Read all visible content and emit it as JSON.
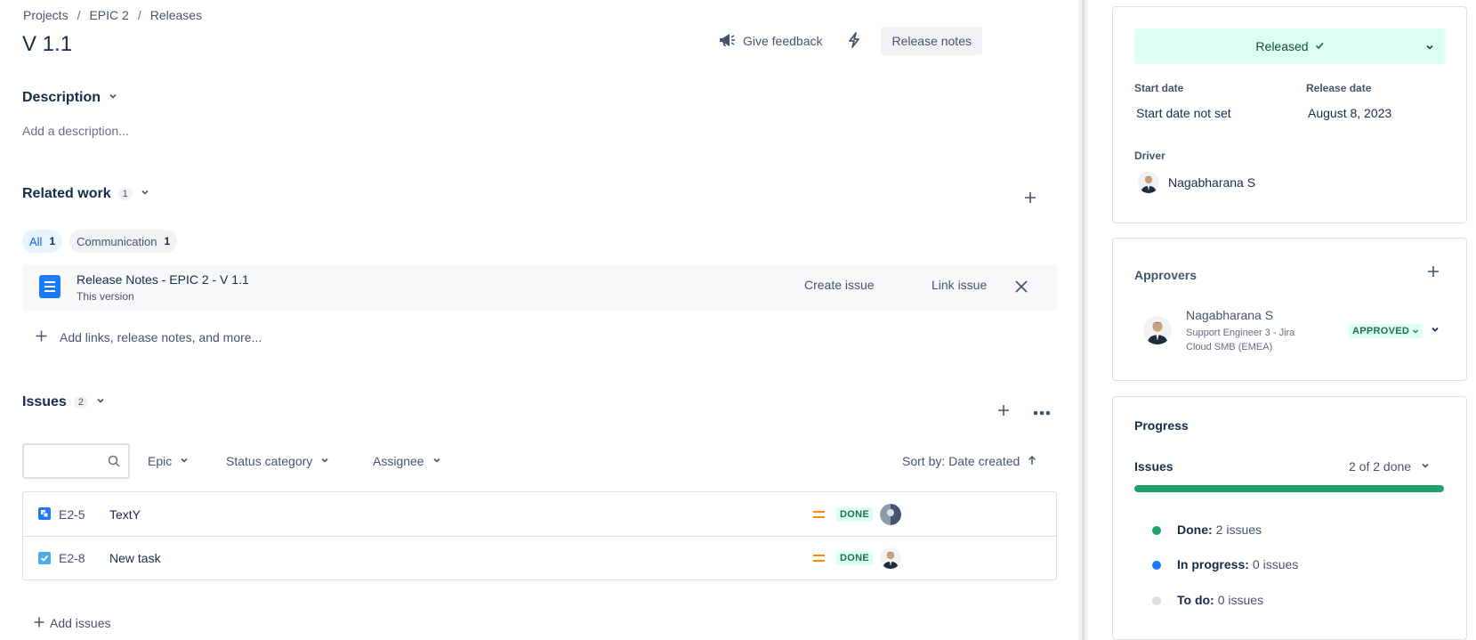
{
  "breadcrumb": [
    "Projects",
    "EPIC 2",
    "Releases"
  ],
  "page_title": "V 1.1",
  "header": {
    "feedback_label": "Give feedback",
    "release_notes_label": "Release notes"
  },
  "description": {
    "title": "Description",
    "placeholder": "Add a description..."
  },
  "related_work": {
    "title": "Related work",
    "count": "1",
    "chips": [
      {
        "label": "All",
        "count": "1"
      },
      {
        "label": "Communication",
        "count": "1"
      }
    ],
    "item": {
      "title": "Release Notes - EPIC 2 - V 1.1",
      "subtitle": "This version",
      "create_issue": "Create issue",
      "link_issue": "Link issue"
    },
    "add_links": "Add links, release notes, and more..."
  },
  "issues": {
    "title": "Issues",
    "count": "2",
    "filters": {
      "epic": "Epic",
      "status_category": "Status category",
      "assignee": "Assignee",
      "sort": "Sort by: Date created"
    },
    "rows": [
      {
        "key": "E2-5",
        "summary": "TextY",
        "status": "DONE",
        "type": "story"
      },
      {
        "key": "E2-8",
        "summary": "New task",
        "status": "DONE",
        "type": "task"
      }
    ],
    "add_label": "Add issues"
  },
  "details": {
    "status": "Released",
    "start_label": "Start date",
    "start_value": "Start date not set",
    "release_label": "Release date",
    "release_value": "August 8, 2023",
    "driver_label": "Driver",
    "driver_name": "Nagabharana S"
  },
  "approvers": {
    "title": "Approvers",
    "name": "Nagabharana S",
    "role": "Support Engineer 3 - Jira Cloud SMB (EMEA)",
    "status": "APPROVED"
  },
  "progress": {
    "title": "Progress",
    "issues_label": "Issues",
    "summary": "2 of 2 done",
    "fraction_done": 1.0,
    "legend": [
      {
        "label": "Done:",
        "value": "2 issues",
        "color": "#22a06b"
      },
      {
        "label": "In progress:",
        "value": "0 issues",
        "color": "#1d7afc"
      },
      {
        "label": "To do:",
        "value": "0 issues",
        "color": "#dcdfe4"
      }
    ]
  },
  "colors": {
    "accent": "#0c66e4",
    "success": "#22a06b",
    "success_bg": "#dcfff1",
    "priority": "#ff8b00"
  }
}
